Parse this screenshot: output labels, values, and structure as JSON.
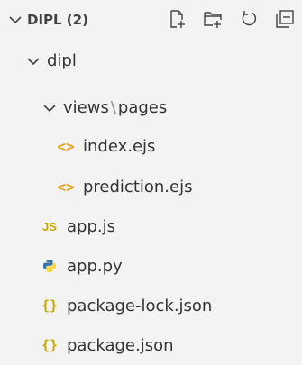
{
  "explorer": {
    "title": "DIPL (2)",
    "actions": [
      {
        "name": "new-file-icon"
      },
      {
        "name": "new-folder-icon"
      },
      {
        "name": "refresh-icon"
      },
      {
        "name": "collapse-all-icon"
      }
    ]
  },
  "tree": {
    "folder": "dipl",
    "subfolder_a": "views",
    "subfolder_sep": "\\",
    "subfolder_b": "pages",
    "files": {
      "index": "index.ejs",
      "prediction": "prediction.ejs",
      "appjs": "app.js",
      "apppy": "app.py",
      "pkglock": "package-lock.json",
      "pkg": "package.json"
    },
    "icons": {
      "js_text": "JS",
      "json_text": "{}"
    }
  },
  "colors": {
    "ejs_icon": "#e5a324",
    "js_icon": "#c8a800",
    "json_icon": "#c8a800",
    "python_blue": "#3572A5",
    "python_yellow": "#FFD43B"
  }
}
